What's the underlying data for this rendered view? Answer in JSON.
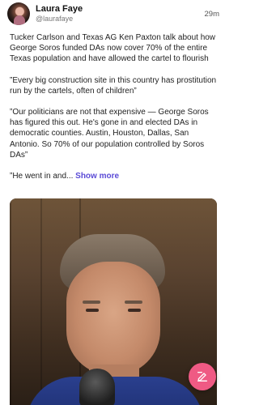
{
  "post": {
    "author_name": "Laura Faye",
    "author_handle": "@laurafaye",
    "timestamp": "29m",
    "paragraphs": [
      "Tucker Carlson and Texas AG Ken Paxton talk about how George Soros funded DAs now cover 70% of the entire Texas population and have allowed the cartel to flourish",
      "”Every big construction site in this country has prostitution run by the cartels, often of children”",
      "”Our politicians are not that expensive — George Soros has figured this out. He's gone in and elected DAs in democratic counties. Austin, Houston, Dallas, San Antonio. So 70% of our population controlled by Soros DAs”"
    ],
    "truncated_text": "”He went in and...",
    "show_more_label": "Show more"
  },
  "fab": {
    "icon": "edit-icon",
    "color": "#ef5a84"
  },
  "accent_color": "#5a4ad6"
}
